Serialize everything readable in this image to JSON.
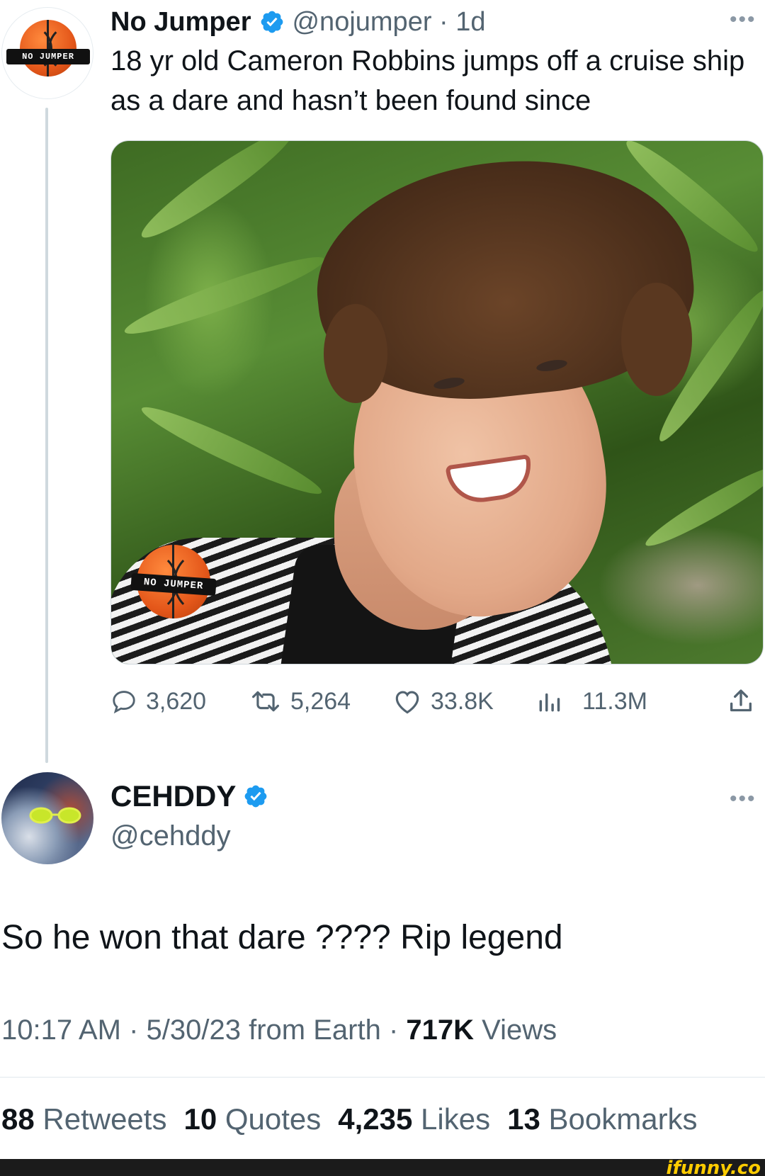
{
  "parent_tweet": {
    "author_name": "No Jumper",
    "handle_time": "@nojumper · 1d",
    "avatar_logo_text": "NO JUMPER",
    "text": "18 yr old Cameron Robbins jumps off a cruise ship as a dare and hasn’t been found since",
    "media_watermark": "NO JUMPER",
    "actions": {
      "replies": "3,620",
      "retweets": "5,264",
      "likes": "33.8K",
      "views": "11.3M"
    }
  },
  "reply_tweet": {
    "author_name": "CEHDDY",
    "handle": "@cehddy",
    "text": "So he won that dare ???? Rip legend",
    "timestamp": "10:17 AM · 5/30/23 from Earth · ",
    "views_count": "717K",
    "views_label": " Views",
    "stats": {
      "retweets_count": "88",
      "retweets_label": " Retweets",
      "quotes_count": "10",
      "quotes_label": " Quotes",
      "likes_count": "4,235",
      "likes_label": " Likes",
      "bookmarks_count": "13",
      "bookmarks_label": " Bookmarks"
    }
  },
  "watermark": "ifunny.co",
  "colors": {
    "verified": "#1d9bf0",
    "secondary_text": "#536471",
    "primary_text": "#0f1419"
  }
}
